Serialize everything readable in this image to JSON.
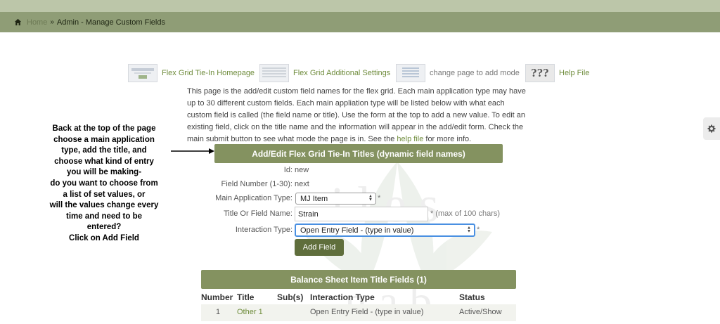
{
  "breadcrumb": {
    "home_icon": "home-icon",
    "home_label": "Home",
    "separator": "»",
    "current": "Admin - Manage Custom Fields"
  },
  "nav": {
    "items": [
      {
        "label": "Flex Grid Tie-In Homepage",
        "icon": "homepage-thumbnail"
      },
      {
        "label": "Flex Grid Additional Settings",
        "icon": "settings-thumbnail"
      },
      {
        "label": "change page to add mode",
        "icon": "add-mode-thumbnail"
      },
      {
        "label": "Help File",
        "icon": "help-thumbnail",
        "thumb_text": "???"
      }
    ]
  },
  "intro": {
    "text": "This page is the add/edit custom field names for the flex grid. Each main application type may have up to 30 different custom fields. Each main appliation type will be listed below with what each custom field is called (the field name or title). Use the form at the top to add a new value. To edit an existing field, click on the title name and the information will appear in the add/edit form. Check the main submit button to see what mode the page is in. See the ",
    "link": "help file",
    "suffix": " for more info."
  },
  "callout": {
    "lines": [
      "Back at the top of the page",
      "choose a main application",
      "type, add the title, and",
      "choose what kind of entry",
      "you will be making-",
      "do you want to choose from",
      "a list of set values, or",
      "will the values change every",
      "time and need to be",
      "entered?",
      "Click on Add Field"
    ]
  },
  "form": {
    "header": "Add/Edit Flex Grid Tie-In Titles (dynamic field names)",
    "id_label": "Id:",
    "id_value": "new",
    "field_number_label": "Field Number (1-30):",
    "field_number_value": "next",
    "app_type_label": "Main Application Type:",
    "app_type_value": "MJ Item",
    "required_mark": "*",
    "title_label": "Title Or Field Name:",
    "title_value": "Strain",
    "title_note": "* (max of 100 chars)",
    "interaction_label": "Interaction Type:",
    "interaction_value": "Open Entry Field - (type in value)",
    "submit_label": "Add Field"
  },
  "table": {
    "header": "Balance Sheet Item Title Fields (1)",
    "columns": [
      "Number",
      "Title",
      "Sub(s)",
      "Interaction Type",
      "Status"
    ],
    "rows": [
      {
        "number": "1",
        "title": "Other 1",
        "subs": "",
        "interaction": "Open Entry Field - (type in value)",
        "status": "Active/Show"
      }
    ]
  },
  "side_tab": {
    "icon": "gear-icon"
  },
  "colors": {
    "breadcrumb_bar": "#8f9d76",
    "top_band": "#bcc6a9",
    "section_header": "#849260",
    "button": "#5f6e3c",
    "link": "#6f8c3c",
    "focus_ring": "#4a90e2"
  }
}
